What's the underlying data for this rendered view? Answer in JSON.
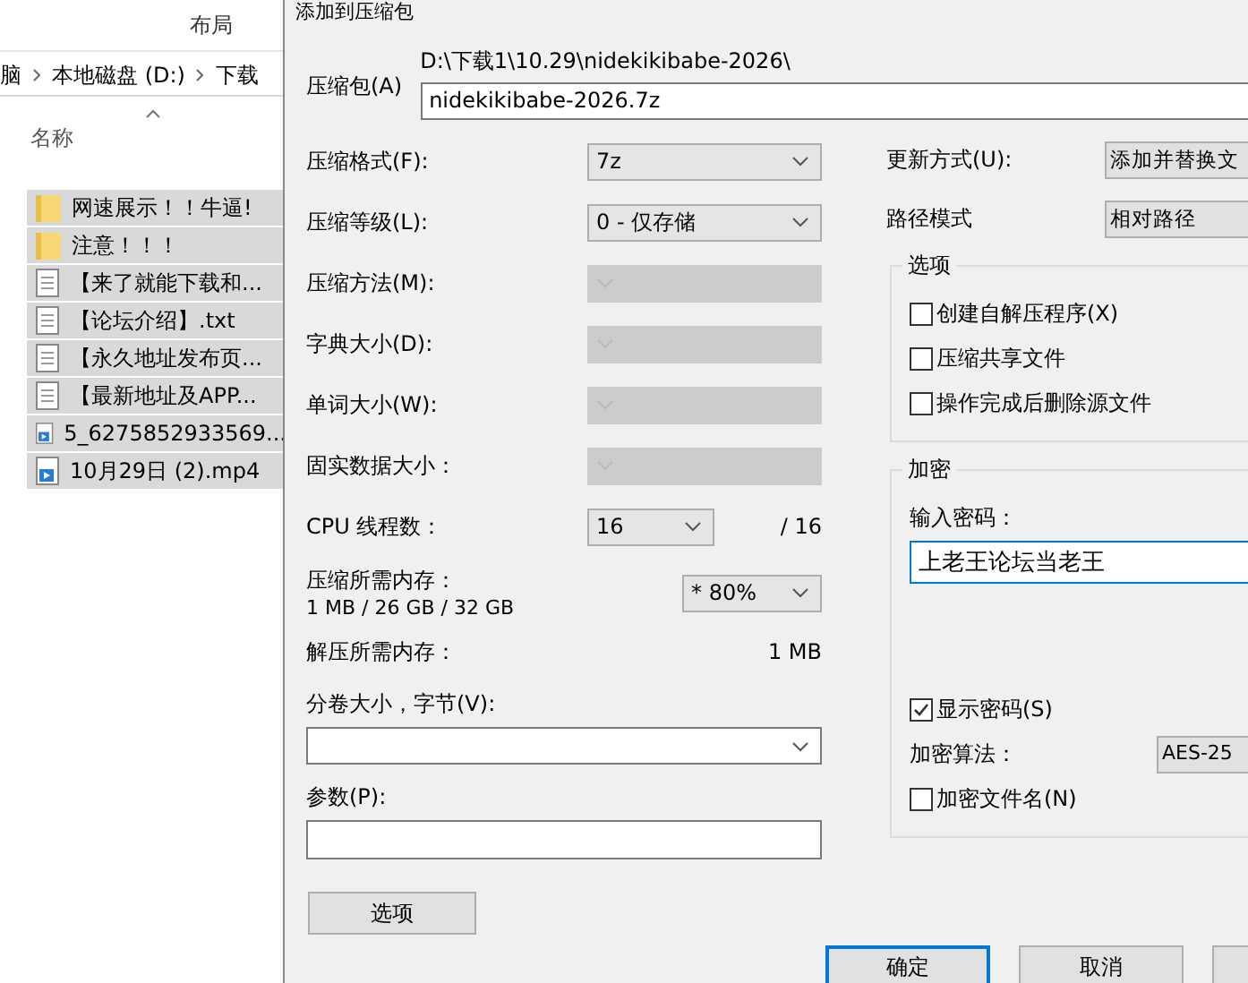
{
  "explorer": {
    "ribbon_tab": "布局",
    "breadcrumb": [
      "脑",
      "本地磁盘 (D:)",
      "下载"
    ],
    "column": "名称",
    "files": [
      {
        "name": "网速展示！！牛逼!",
        "kind": "folder",
        "selected": true
      },
      {
        "name": "注意！！！",
        "kind": "folder",
        "selected": true
      },
      {
        "name": "【来了就能下载和...",
        "kind": "text",
        "selected": true
      },
      {
        "name": "【论坛介绍】.txt",
        "kind": "text",
        "selected": true
      },
      {
        "name": "【永久地址发布页...",
        "kind": "text",
        "selected": true
      },
      {
        "name": "【最新地址及APP...",
        "kind": "text",
        "selected": true
      },
      {
        "name": "5_6275852933569...",
        "kind": "video",
        "selected": true
      },
      {
        "name": "10月29日 (2).mp4",
        "kind": "video",
        "selected": true
      }
    ]
  },
  "dialog": {
    "title": "添加到压缩包",
    "archive": {
      "label": "压缩包(A)",
      "path": "D:\\下载1\\10.29\\nidekikibabe-2026\\",
      "value": "nidekikibabe-2026.7z"
    },
    "settings": [
      {
        "label": "压缩格式(F):",
        "value": "7z",
        "disabled": false
      },
      {
        "label": "压缩等级(L):",
        "value": "0 - 仅存储",
        "disabled": false
      },
      {
        "label": "压缩方法(M):",
        "disabled": true
      },
      {
        "label": "字典大小(D):",
        "disabled": true
      },
      {
        "label": "单词大小(W):",
        "disabled": true
      },
      {
        "label": "固实数据大小：",
        "disabled": true
      }
    ],
    "cpu": {
      "label": "CPU 线程数：",
      "value": "16",
      "total": "/ 16"
    },
    "memory": {
      "label": "压缩所需内存：",
      "detail": "1 MB / 26 GB / 32 GB",
      "value": "* 80%"
    },
    "decompress": {
      "label": "解压所需内存：",
      "value": "1 MB"
    },
    "volume": {
      "label": "分卷大小，字节(V):"
    },
    "params": {
      "label": "参数(P):"
    },
    "options_button": "选项",
    "update": {
      "label": "更新方式(U):",
      "value": "添加并替换文"
    },
    "path_mode": {
      "label": "路径模式",
      "value": "相对路径"
    },
    "options_group": {
      "title": "选项",
      "checks": [
        {
          "label": "创建自解压程序(X)",
          "checked": false
        },
        {
          "label": "压缩共享文件",
          "checked": false
        },
        {
          "label": "操作完成后删除源文件",
          "checked": false
        }
      ]
    },
    "encryption": {
      "title": "加密",
      "password_label": "输入密码：",
      "password": "上老王论坛当老王",
      "show_password": {
        "label": "显示密码(S)",
        "checked": true
      },
      "method_label": "加密算法：",
      "method": "AES-25",
      "encrypt_names": {
        "label": "加密文件名(N)",
        "checked": false
      }
    },
    "buttons": [
      {
        "label": "确定",
        "default": true
      },
      {
        "label": "取消",
        "default": false
      }
    ]
  }
}
